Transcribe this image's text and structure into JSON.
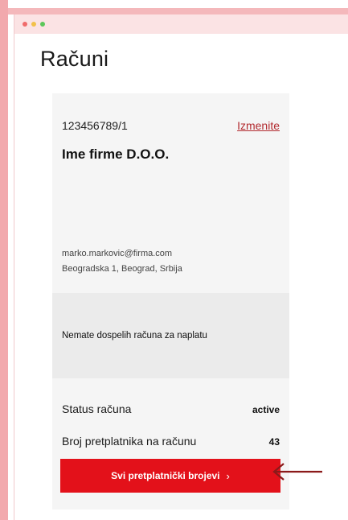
{
  "window": {
    "controls": [
      "close",
      "minimize",
      "maximize"
    ]
  },
  "page": {
    "title": "Računi"
  },
  "account": {
    "number": "123456789/1",
    "edit_label": "Izmenite",
    "company": "Ime firme D.O.O.",
    "email": "marko.markovic@firma.com",
    "address": "Beogradska 1, Beograd, Srbija"
  },
  "notice": {
    "text": "Nemate dospelih računa za naplatu"
  },
  "details": {
    "status_label": "Status računa",
    "status_value": "active",
    "subscribers_label": "Broj pretplatnika na računu",
    "subscribers_value": "43"
  },
  "cta": {
    "label": "Svi pretplatnički brojevi",
    "chevron": "›"
  },
  "colors": {
    "brand_red": "#e3111a",
    "link_red": "#b22a2f",
    "annotation_arrow": "#8b1a1a",
    "frame_pink": "#f2a9ad"
  },
  "icons": {
    "cta_chevron": "chevron-right-icon",
    "annotation": "arrow-left-icon"
  }
}
